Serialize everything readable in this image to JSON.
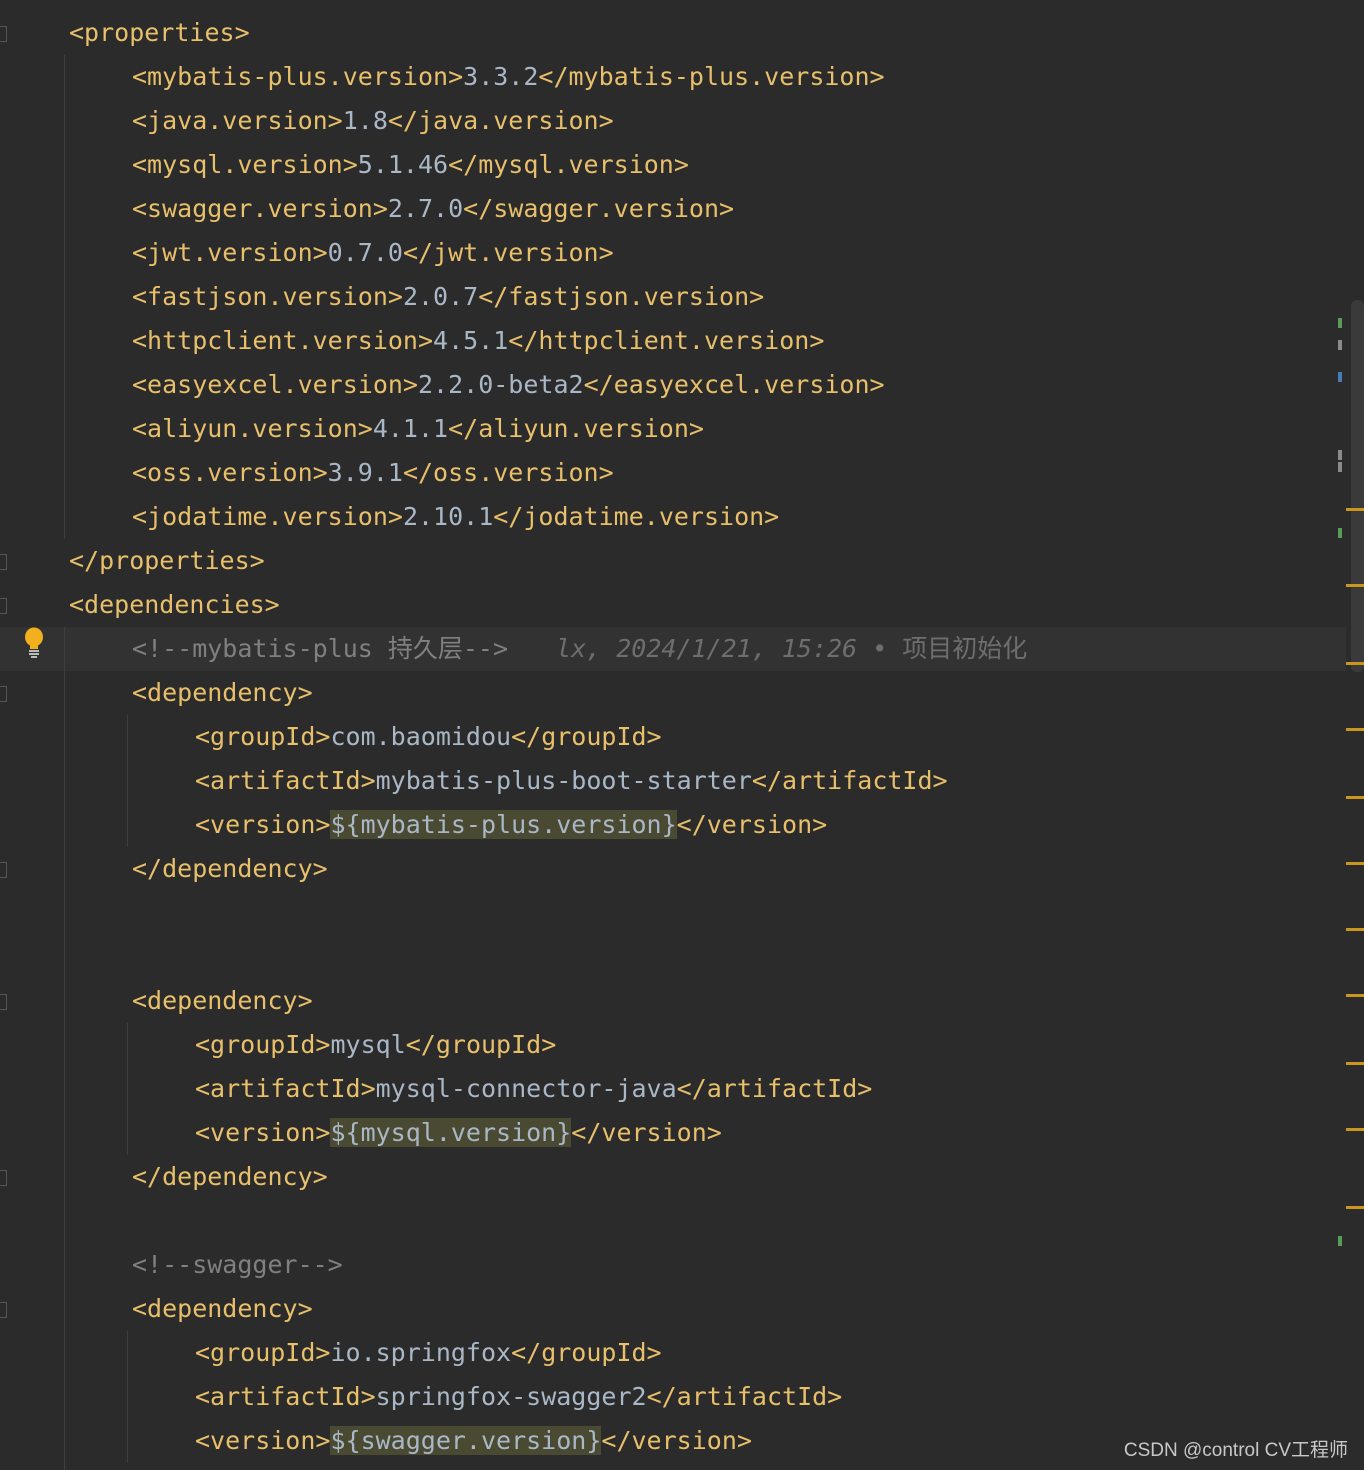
{
  "editor": {
    "lines": [
      {
        "indent": 0,
        "parts": [
          {
            "t": "tag",
            "v": "<properties>"
          }
        ]
      },
      {
        "indent": 1,
        "parts": [
          {
            "t": "tag",
            "v": "<mybatis-plus.version>"
          },
          {
            "t": "val",
            "v": "3.3.2"
          },
          {
            "t": "tag",
            "v": "</mybatis-plus.version>"
          }
        ]
      },
      {
        "indent": 1,
        "parts": [
          {
            "t": "tag",
            "v": "<java.version>"
          },
          {
            "t": "val",
            "v": "1.8"
          },
          {
            "t": "tag",
            "v": "</java.version>"
          }
        ]
      },
      {
        "indent": 1,
        "parts": [
          {
            "t": "tag",
            "v": "<mysql.version>"
          },
          {
            "t": "val",
            "v": "5.1.46"
          },
          {
            "t": "tag",
            "v": "</mysql.version>"
          }
        ]
      },
      {
        "indent": 1,
        "parts": [
          {
            "t": "tag",
            "v": "<swagger.version>"
          },
          {
            "t": "val",
            "v": "2.7.0"
          },
          {
            "t": "tag",
            "v": "</swagger.version>"
          }
        ]
      },
      {
        "indent": 1,
        "parts": [
          {
            "t": "tag",
            "v": "<jwt.version>"
          },
          {
            "t": "val",
            "v": "0.7.0"
          },
          {
            "t": "tag",
            "v": "</jwt.version>"
          }
        ]
      },
      {
        "indent": 1,
        "parts": [
          {
            "t": "tag",
            "v": "<fastjson.version>"
          },
          {
            "t": "val",
            "v": "2.0.7"
          },
          {
            "t": "tag",
            "v": "</fastjson.version>"
          }
        ]
      },
      {
        "indent": 1,
        "parts": [
          {
            "t": "tag",
            "v": "<httpclient.version>"
          },
          {
            "t": "val",
            "v": "4.5.1"
          },
          {
            "t": "tag",
            "v": "</httpclient.version>"
          }
        ]
      },
      {
        "indent": 1,
        "parts": [
          {
            "t": "tag",
            "v": "<easyexcel.version>"
          },
          {
            "t": "val",
            "v": "2.2.0-beta2"
          },
          {
            "t": "tag",
            "v": "</easyexcel.version>"
          }
        ]
      },
      {
        "indent": 1,
        "parts": [
          {
            "t": "tag",
            "v": "<aliyun.version>"
          },
          {
            "t": "val",
            "v": "4.1.1"
          },
          {
            "t": "tag",
            "v": "</aliyun.version>"
          }
        ]
      },
      {
        "indent": 1,
        "parts": [
          {
            "t": "tag",
            "v": "<oss.version>"
          },
          {
            "t": "val",
            "v": "3.9.1"
          },
          {
            "t": "tag",
            "v": "</oss.version>"
          }
        ]
      },
      {
        "indent": 1,
        "parts": [
          {
            "t": "tag",
            "v": "<jodatime.version>"
          },
          {
            "t": "val",
            "v": "2.10.1"
          },
          {
            "t": "tag",
            "v": "</jodatime.version>"
          }
        ]
      },
      {
        "indent": 0,
        "parts": [
          {
            "t": "tag",
            "v": "</properties>"
          }
        ]
      },
      {
        "indent": 0,
        "parts": [
          {
            "t": "tag",
            "v": "<dependencies>"
          }
        ]
      },
      {
        "indent": 1,
        "active": true,
        "parts": [
          {
            "t": "cmt",
            "v": "<!--mybatis-plus 持久层-->"
          }
        ],
        "blame": {
          "author": "lx",
          "date": "2024/1/21, 15:26",
          "separator": "•",
          "message": "项目初始化"
        }
      },
      {
        "indent": 1,
        "parts": [
          {
            "t": "tag",
            "v": "<dependency>"
          }
        ]
      },
      {
        "indent": 2,
        "parts": [
          {
            "t": "tag",
            "v": "<groupId>"
          },
          {
            "t": "val",
            "v": "com.baomidou"
          },
          {
            "t": "tag",
            "v": "</groupId>"
          }
        ]
      },
      {
        "indent": 2,
        "parts": [
          {
            "t": "tag",
            "v": "<artifactId>"
          },
          {
            "t": "val",
            "v": "mybatis-plus-boot-starter"
          },
          {
            "t": "tag",
            "v": "</artifactId>"
          }
        ]
      },
      {
        "indent": 2,
        "parts": [
          {
            "t": "tag",
            "v": "<version>"
          },
          {
            "t": "hl",
            "v": "${mybatis-plus.version}"
          },
          {
            "t": "tag",
            "v": "</version>"
          }
        ]
      },
      {
        "indent": 1,
        "parts": [
          {
            "t": "tag",
            "v": "</dependency>"
          }
        ]
      },
      {
        "indent": 0,
        "parts": []
      },
      {
        "indent": 0,
        "parts": []
      },
      {
        "indent": 1,
        "parts": [
          {
            "t": "tag",
            "v": "<dependency>"
          }
        ]
      },
      {
        "indent": 2,
        "parts": [
          {
            "t": "tag",
            "v": "<groupId>"
          },
          {
            "t": "val",
            "v": "mysql"
          },
          {
            "t": "tag",
            "v": "</groupId>"
          }
        ]
      },
      {
        "indent": 2,
        "parts": [
          {
            "t": "tag",
            "v": "<artifactId>"
          },
          {
            "t": "val",
            "v": "mysql-connector-java"
          },
          {
            "t": "tag",
            "v": "</artifactId>"
          }
        ]
      },
      {
        "indent": 2,
        "parts": [
          {
            "t": "tag",
            "v": "<version>"
          },
          {
            "t": "hl",
            "v": "${mysql.version}"
          },
          {
            "t": "tag",
            "v": "</version>"
          }
        ]
      },
      {
        "indent": 1,
        "parts": [
          {
            "t": "tag",
            "v": "</dependency>"
          }
        ]
      },
      {
        "indent": 0,
        "parts": []
      },
      {
        "indent": 1,
        "parts": [
          {
            "t": "cmt",
            "v": "<!--swagger-->"
          }
        ]
      },
      {
        "indent": 1,
        "parts": [
          {
            "t": "tag",
            "v": "<dependency>"
          }
        ]
      },
      {
        "indent": 2,
        "parts": [
          {
            "t": "tag",
            "v": "<groupId>"
          },
          {
            "t": "val",
            "v": "io.springfox"
          },
          {
            "t": "tag",
            "v": "</groupId>"
          }
        ]
      },
      {
        "indent": 2,
        "parts": [
          {
            "t": "tag",
            "v": "<artifactId>"
          },
          {
            "t": "val",
            "v": "springfox-swagger2"
          },
          {
            "t": "tag",
            "v": "</artifactId>"
          }
        ]
      },
      {
        "indent": 2,
        "parts": [
          {
            "t": "tag",
            "v": "<version>"
          },
          {
            "t": "hl",
            "v": "${swagger.version}"
          },
          {
            "t": "tag",
            "v": "</version>"
          }
        ]
      }
    ]
  },
  "colors": {
    "background": "#2b2b2b",
    "tag": "#e8bf6a",
    "value": "#a9b7c6",
    "comment": "#808080",
    "highlight": "#4a4a33",
    "change_marker": "#c9961e"
  },
  "icons": {
    "intention": "lightbulb-icon"
  },
  "watermark": "CSDN @control CV工程师"
}
